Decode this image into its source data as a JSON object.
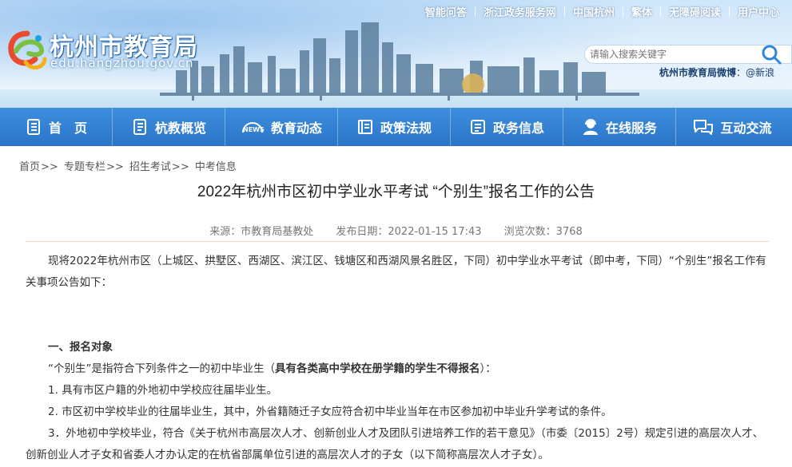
{
  "site": {
    "name_cn": "杭州市教育局",
    "domain": "edu.hangzhou.gov.cn"
  },
  "top_links": [
    "智能问答",
    "浙江政务服务网",
    "中国杭州",
    "繁体",
    "无障碍阅读",
    "用户中心"
  ],
  "search": {
    "placeholder": "请输入搜索关键字"
  },
  "weibo": {
    "label": "杭州市教育局微博",
    "handle": "@新浪"
  },
  "nav": [
    {
      "label": "首　页",
      "icon": "home-doc-icon"
    },
    {
      "label": "杭教概览",
      "icon": "overview-doc-icon"
    },
    {
      "label": "教育动态",
      "icon": "news-icon"
    },
    {
      "label": "政策法规",
      "icon": "policy-book-icon"
    },
    {
      "label": "政务信息",
      "icon": "gov-info-icon"
    },
    {
      "label": "在线服务",
      "icon": "service-person-icon"
    },
    {
      "label": "互动交流",
      "icon": "chat-bubbles-icon"
    }
  ],
  "breadcrumb": {
    "items": [
      "首页",
      "专题专栏",
      "招生考试",
      "中考信息"
    ],
    "separator": ">>"
  },
  "article": {
    "title": "2022年杭州市区初中学业水平考试 “个别生”报名工作的公告",
    "source": "来源：市教育局基教处",
    "date": "发布日期：2022-01-15 17:43",
    "views": "浏览次数：3768",
    "intro": "现将2022年杭州市区（上城区、拱墅区、西湖区、滨江区、钱塘区和西湖风景名胜区，下同）初中学业水平考试（即中考，下同）“个别生”报名工作有关事项公告如下：",
    "section1_heading": "一、报名对象",
    "section1_lead_a": "“个别生”是指符合下列条件之一的初中毕业生（",
    "section1_lead_bold": "具有各类高中学校在册学籍的学生不得报名",
    "section1_lead_b": "）：",
    "item1": "1. 具有市区户籍的外地初中学校应往届毕业生。",
    "item2": "2. 市区初中学校毕业的往届毕业生，其中，外省籍随迁子女应符合初中毕业当年在市区参加初中毕业升学考试的条件。",
    "item3": "3．外地初中学校毕业，符合《关于杭州市高层次人才、创新创业人才及团队引进培养工作的若干意见》（市委〔2015〕2号）规定引进的高层次人才、创新创业人才子女和省委人才办认定的在杭省部属单位引进的高层次人才的子女（以下简称高层次人才子女）。"
  },
  "colors": {
    "nav_bg": "#2a74c8",
    "nav_text": "#ffffff",
    "rule": "#e6d9c5"
  }
}
